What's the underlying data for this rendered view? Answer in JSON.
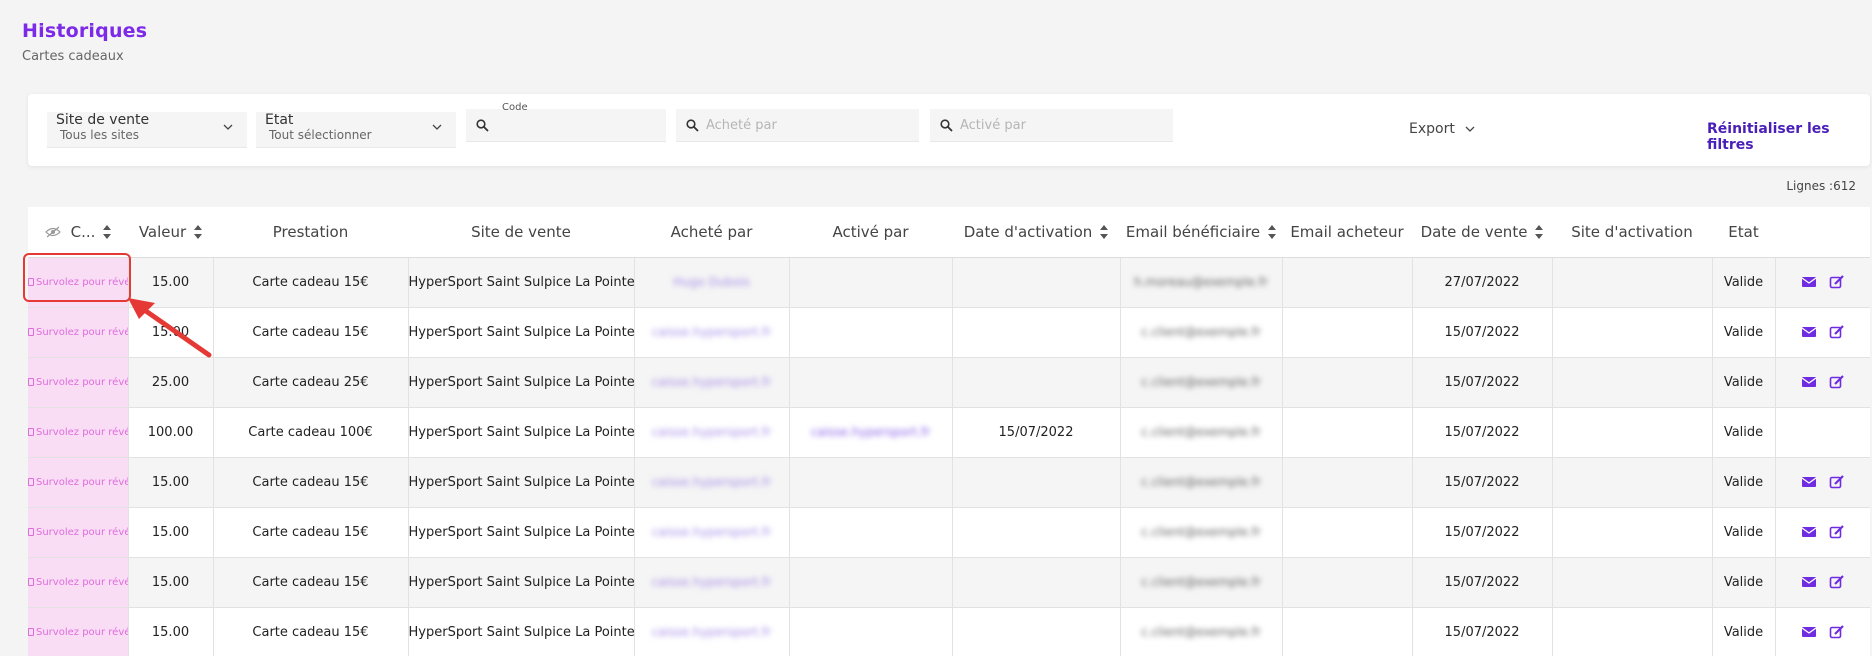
{
  "header": {
    "title": "Historiques",
    "subtitle": "Cartes cadeaux"
  },
  "filters": {
    "site": {
      "label": "Site de vente",
      "value": "Tous les sites"
    },
    "etat": {
      "label": "Etat",
      "value": "Tout sélectionner"
    },
    "code": {
      "label": "Code",
      "placeholder": ""
    },
    "achete": {
      "placeholder": "Acheté par"
    },
    "active": {
      "placeholder": "Activé par"
    },
    "export_label": "Export",
    "reset_label": "Réinitialiser les filtres"
  },
  "row_count": "Lignes :612",
  "table": {
    "columns": [
      "C...",
      "Valeur",
      "Prestation",
      "Site de vente",
      "Acheté par",
      "Activé par",
      "Date d'activation",
      "Email bénéficiaire",
      "Email acheteur",
      "Date de vente",
      "Site d'activation",
      "Etat"
    ],
    "code_placeholder": "Survolez pour révéler",
    "rows": [
      {
        "valeur": "15.00",
        "prestation": "Carte cadeau 15€",
        "site": "HyperSport Saint Sulpice La Pointe",
        "achete": "Hugo Dubois",
        "active": "",
        "date_activation": "",
        "email_benef": "h.moreau@exemple.fr",
        "email_acheteur": "",
        "date_vente": "27/07/2022",
        "site_activation": "",
        "etat": "Valide",
        "actions": true
      },
      {
        "valeur": "15.00",
        "prestation": "Carte cadeau 15€",
        "site": "HyperSport Saint Sulpice La Pointe",
        "achete": "caisse.hypersport.fr",
        "active": "",
        "date_activation": "",
        "email_benef": "c.client@exemple.fr",
        "email_acheteur": "",
        "date_vente": "15/07/2022",
        "site_activation": "",
        "etat": "Valide",
        "actions": true
      },
      {
        "valeur": "25.00",
        "prestation": "Carte cadeau 25€",
        "site": "HyperSport Saint Sulpice La Pointe",
        "achete": "caisse.hypersport.fr",
        "active": "",
        "date_activation": "",
        "email_benef": "c.client@exemple.fr",
        "email_acheteur": "",
        "date_vente": "15/07/2022",
        "site_activation": "",
        "etat": "Valide",
        "actions": true
      },
      {
        "valeur": "100.00",
        "prestation": "Carte cadeau 100€",
        "site": "HyperSport Saint Sulpice La Pointe",
        "achete": "caisse.hypersport.fr",
        "active": "caisse.hypersport.fr",
        "date_activation": "15/07/2022",
        "email_benef": "c.client@exemple.fr",
        "email_acheteur": "",
        "date_vente": "15/07/2022",
        "site_activation": "",
        "etat": "Valide",
        "actions": false
      },
      {
        "valeur": "15.00",
        "prestation": "Carte cadeau 15€",
        "site": "HyperSport Saint Sulpice La Pointe",
        "achete": "caisse.hypersport.fr",
        "active": "",
        "date_activation": "",
        "email_benef": "c.client@exemple.fr",
        "email_acheteur": "",
        "date_vente": "15/07/2022",
        "site_activation": "",
        "etat": "Valide",
        "actions": true
      },
      {
        "valeur": "15.00",
        "prestation": "Carte cadeau 15€",
        "site": "HyperSport Saint Sulpice La Pointe",
        "achete": "caisse.hypersport.fr",
        "active": "",
        "date_activation": "",
        "email_benef": "c.client@exemple.fr",
        "email_acheteur": "",
        "date_vente": "15/07/2022",
        "site_activation": "",
        "etat": "Valide",
        "actions": true
      },
      {
        "valeur": "15.00",
        "prestation": "Carte cadeau 15€",
        "site": "HyperSport Saint Sulpice La Pointe",
        "achete": "caisse.hypersport.fr",
        "active": "",
        "date_activation": "",
        "email_benef": "c.client@exemple.fr",
        "email_acheteur": "",
        "date_vente": "15/07/2022",
        "site_activation": "",
        "etat": "Valide",
        "actions": true
      },
      {
        "valeur": "15.00",
        "prestation": "Carte cadeau 15€",
        "site": "HyperSport Saint Sulpice La Pointe",
        "achete": "caisse.hypersport.fr",
        "active": "",
        "date_activation": "",
        "email_benef": "c.client@exemple.fr",
        "email_acheteur": "",
        "date_vente": "15/07/2022",
        "site_activation": "",
        "etat": "Valide",
        "actions": true
      }
    ]
  },
  "colors": {
    "accent": "#7c2ae8",
    "reset": "#4a1fb8",
    "code_bg": "#f9ddf5",
    "code_text": "#e06bde",
    "annotation": "#e53935"
  }
}
